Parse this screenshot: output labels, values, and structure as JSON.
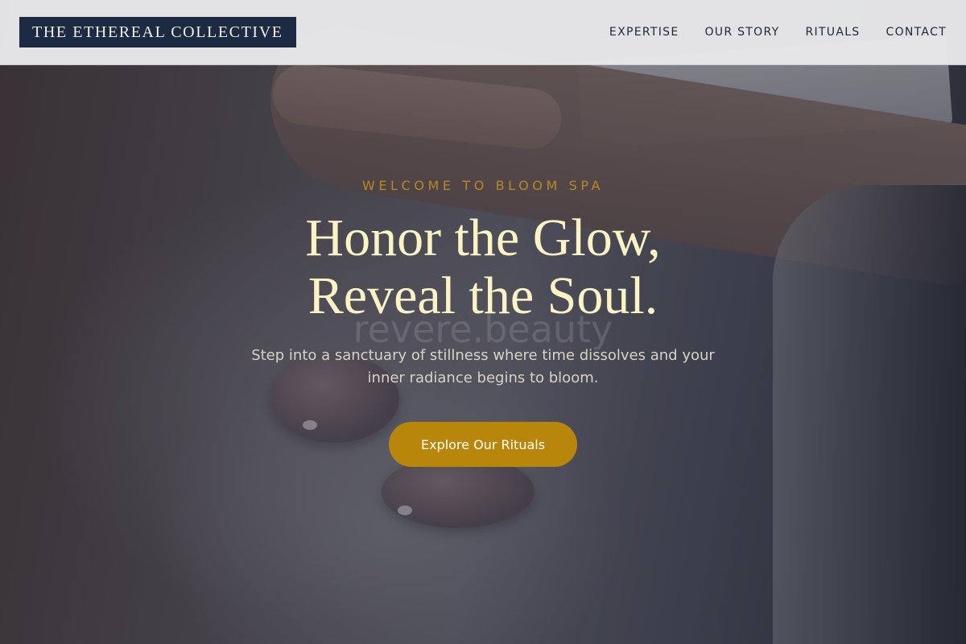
{
  "header": {
    "logo": "THE ETHEREAL COLLECTIVE",
    "nav": [
      {
        "label": "EXPERTISE"
      },
      {
        "label": "OUR STORY"
      },
      {
        "label": "RITUALS"
      },
      {
        "label": "CONTACT"
      }
    ]
  },
  "hero": {
    "eyebrow": "WELCOME TO BLOOM SPA",
    "headline_line1": "Honor the Glow,",
    "headline_line2": "Reveal the Soul.",
    "watermark": "revere.beauty",
    "subtitle": "Step into a sanctuary of stillness where time dissolves and your inner radiance begins to bloom.",
    "cta_label": "Explore Our Rituals"
  },
  "colors": {
    "logo_bg": "#1d2a44",
    "accent_gold": "#b8860b",
    "headline": "#fbf3c4"
  }
}
